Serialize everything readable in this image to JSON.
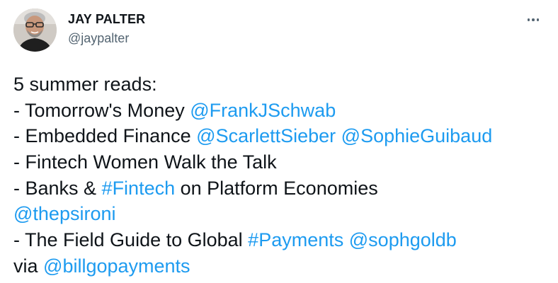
{
  "author": {
    "name": "JAY PALTER",
    "handle": "@jaypalter"
  },
  "more_menu": {
    "icon": "more-horizontal-icon"
  },
  "tweet": {
    "lines": [
      [
        {
          "text": "5 summer reads:"
        }
      ],
      [
        {
          "text": "- Tomorrow's Money "
        },
        {
          "text": "@FrankJSchwab",
          "link": true
        }
      ],
      [
        {
          "text": "- Embedded Finance "
        },
        {
          "text": "@ScarlettSieber",
          "link": true
        },
        {
          "text": " "
        },
        {
          "text": "@SophieGuibaud",
          "link": true
        }
      ],
      [
        {
          "text": "- Fintech Women Walk the Talk"
        }
      ],
      [
        {
          "text": "- Banks & "
        },
        {
          "text": "#Fintech",
          "link": true
        },
        {
          "text": " on Platform Economies"
        }
      ],
      [
        {
          "text": "@thepsironi",
          "link": true
        }
      ],
      [
        {
          "text": "- The Field Guide to Global "
        },
        {
          "text": "#Payments",
          "link": true
        },
        {
          "text": " "
        },
        {
          "text": "@sophgoldb",
          "link": true
        }
      ],
      [
        {
          "text": "via "
        },
        {
          "text": "@billgopayments",
          "link": true
        }
      ]
    ]
  },
  "colors": {
    "text": "#0f1419",
    "secondary": "#536471",
    "link": "#1d9bf0",
    "background": "#ffffff"
  }
}
